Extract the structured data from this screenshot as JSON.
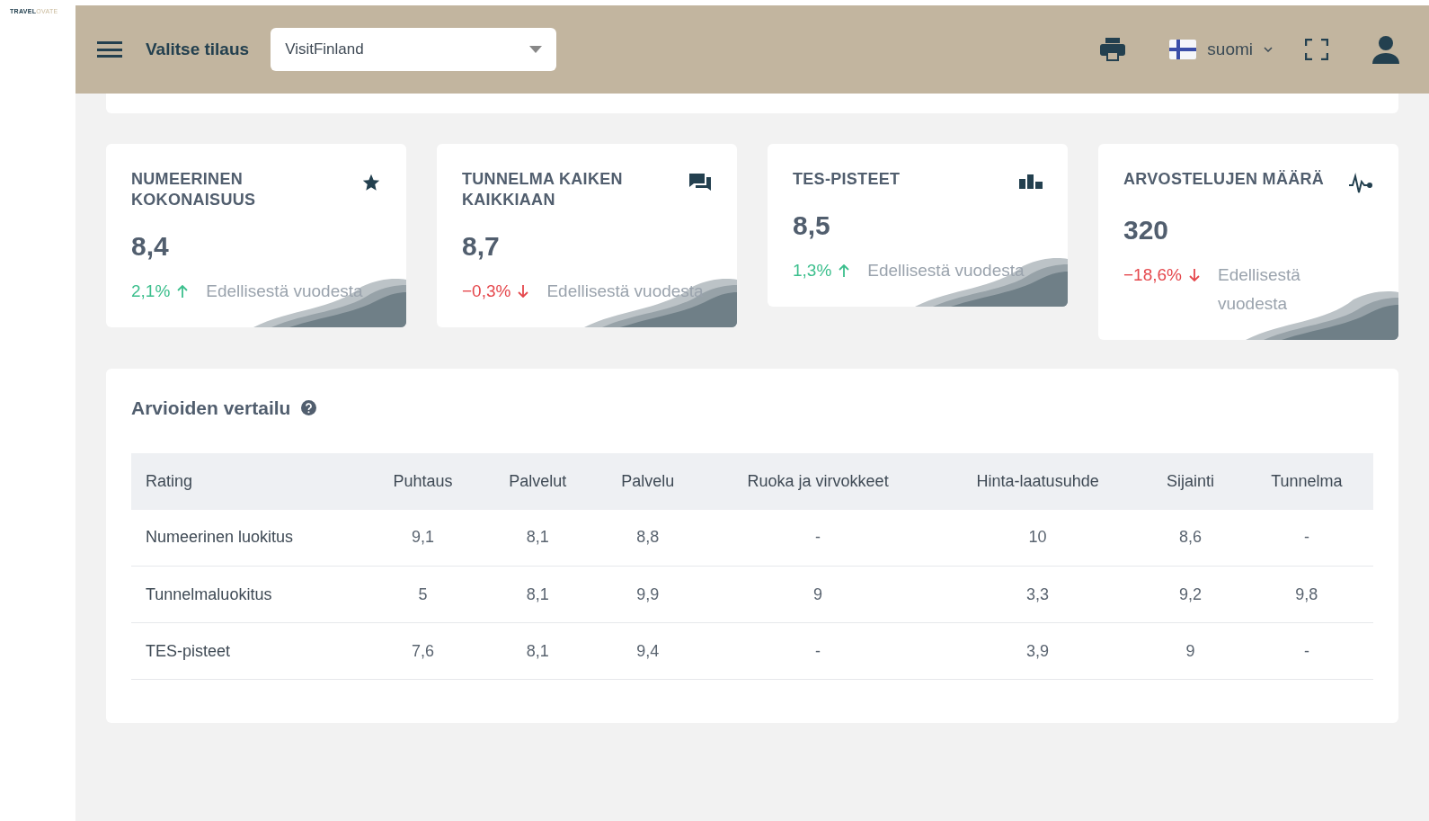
{
  "logo": {
    "part_1": "TRAVEL",
    "part_2": "OVATE"
  },
  "header": {
    "title": "Valitse tilaus",
    "subscription": {
      "value": "VisitFinland"
    },
    "language": "suomi"
  },
  "cards": [
    {
      "title": "NUMEERINEN KOKONAISUUS",
      "value": "8,4",
      "change": "2,1%",
      "kind": "up",
      "caption": "Edellisestä vuodesta"
    },
    {
      "title": "TUNNELMA KAIKEN KAIKKIAAN",
      "value": "8,7",
      "change": "−0,3%",
      "kind": "down",
      "caption": "Edellisestä vuodesta"
    },
    {
      "title": "TES-PISTEET",
      "value": "8,5",
      "change": "1,3%",
      "kind": "up",
      "caption": "Edellisestä vuodesta"
    },
    {
      "title": "ARVOSTELUJEN MÄÄRÄ",
      "value": "320",
      "change": "−18,6%",
      "kind": "down",
      "caption": "Edellisestä vuodesta"
    }
  ],
  "comparison": {
    "title": "Arvioiden vertailu",
    "table": {
      "columns": [
        "Rating",
        "Puhtaus",
        "Palvelut",
        "Palvelu",
        "Ruoka ja virvokkeet",
        "Hinta-laatusuhde",
        "Sijainti",
        "Tunnelma"
      ],
      "rows": [
        [
          "Numeerinen luokitus",
          "9,1",
          "8,1",
          "8,8",
          "-",
          "10",
          "8,6",
          "-"
        ],
        [
          "Tunnelmaluokitus",
          "5",
          "8,1",
          "9,9",
          "9",
          "3,3",
          "9,2",
          "9,8"
        ],
        [
          "TES-pisteet",
          "7,6",
          "8,1",
          "9,4",
          "-",
          "3,9",
          "9",
          "-"
        ]
      ]
    }
  }
}
